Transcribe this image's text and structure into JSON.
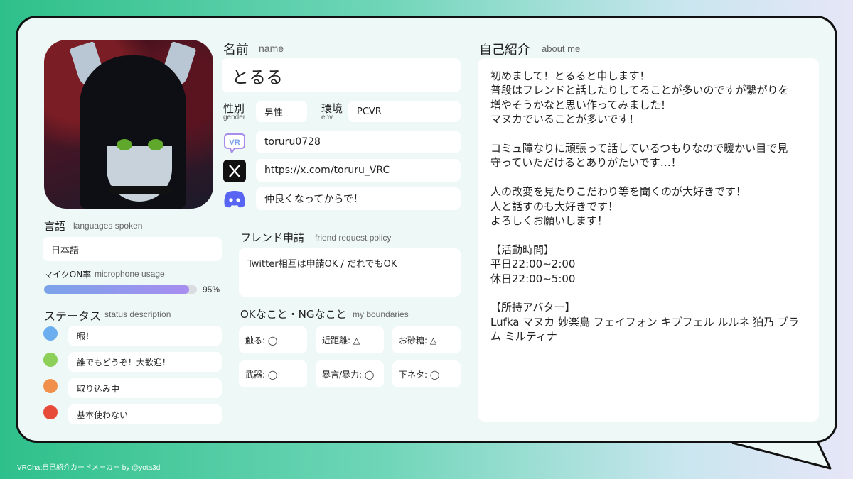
{
  "colors": {
    "accent": "#2ec08a",
    "status_free": "#6aaef0",
    "status_welcome": "#8cd05a",
    "status_busy": "#f0904a",
    "status_off": "#e84a3a"
  },
  "name": {
    "label_jp": "名前",
    "label_en": "name",
    "value": "とるる"
  },
  "gender": {
    "label_jp": "性別",
    "label_en": "gender",
    "value": "男性"
  },
  "env": {
    "label_jp": "環境",
    "label_en": "env",
    "value": "PCVR"
  },
  "links": [
    {
      "icon": "vrchat-icon",
      "value": "toruru0728"
    },
    {
      "icon": "x-icon",
      "value": "https://x.com/toruru_VRC"
    },
    {
      "icon": "discord-icon",
      "value": "仲良くなってからで！"
    }
  ],
  "languages": {
    "label_jp": "言語",
    "label_en": "languages spoken",
    "value": "日本語"
  },
  "mic": {
    "label_jp": "マイクON率",
    "label_en": "microphone usage",
    "value": 0.95,
    "text": "95%"
  },
  "status": {
    "label_jp": "ステータス",
    "label_en": "status description",
    "items": [
      {
        "color": "#6aaef0",
        "text": "暇！"
      },
      {
        "color": "#8cd05a",
        "text": "誰でもどうぞ！大歓迎！"
      },
      {
        "color": "#f0904a",
        "text": "取り込み中"
      },
      {
        "color": "#e84a3a",
        "text": "基本使わない"
      }
    ]
  },
  "friend": {
    "label_jp": "フレンド申請",
    "label_en": "friend request policy",
    "value": "Twitter相互は申請OK / だれでもOK"
  },
  "boundaries": {
    "label_jp": "OKなこと・NGなこと",
    "label_en": "my boundaries",
    "items": [
      "触る: ◯",
      "近距離: △",
      "お砂糖: △",
      "武器: ◯",
      "暴言/暴力: ◯",
      "下ネタ: ◯"
    ]
  },
  "about": {
    "label_jp": "自己紹介",
    "label_en": "about me",
    "lines": [
      "初めまして！とるると申します！",
      "普段はフレンドと話したりしてることが多いのですが繋がりを",
      "増やそうかなと思い作ってみました！",
      "マヌカでいることが多いです！",
      "",
      "コミュ障なりに頑張って話しているつもりなので暖かい目で見",
      "守っていただけるとありがたいです…！",
      "",
      "人の改変を見たりこだわり等を聞くのが大好きです！",
      "人と話すのも大好きです！",
      "よろしくお願いします！",
      "",
      "【活動時間】",
      "平日22:00~2:00",
      "休日22:00~5:00",
      "",
      "【所持アバター】",
      "Lufka マヌカ 妙楽鳥 フェイフォン キプフェル ルルネ 狛乃 プラ",
      "ム ミルティナ"
    ]
  },
  "footer": "VRChat自己紹介カードメーカー by @yota3d"
}
